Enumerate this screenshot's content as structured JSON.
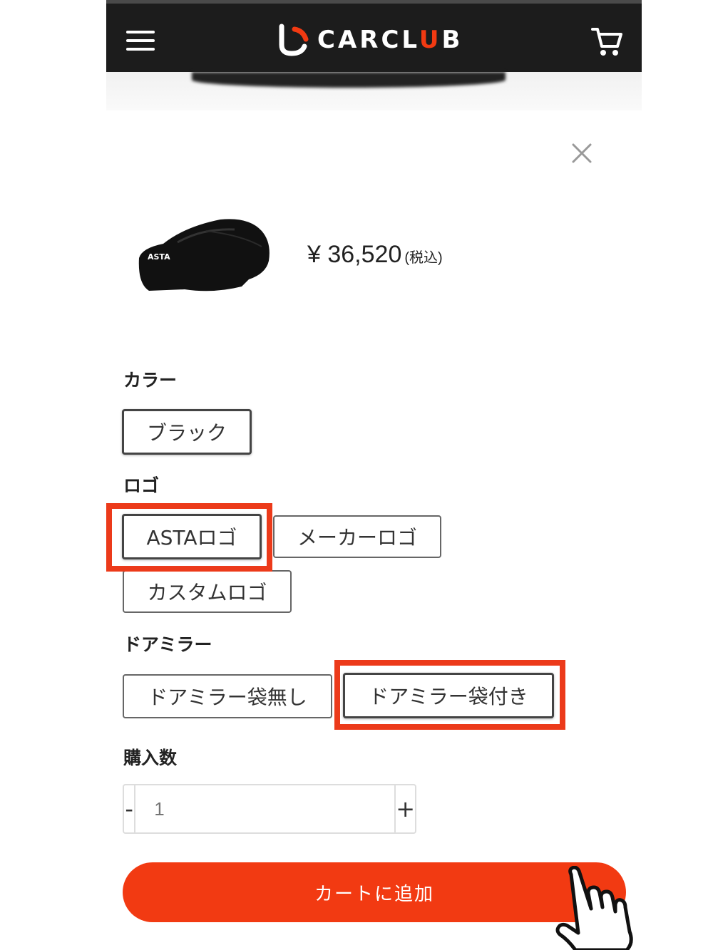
{
  "header": {
    "logo_text_a": "CARCL",
    "logo_text_b": "U",
    "logo_text_c": "B",
    "menu_icon": "hamburger-icon",
    "cart_icon": "shopping-cart-icon"
  },
  "product": {
    "price": "¥ 36,520",
    "tax_note": "(税込)",
    "thumb_logo_text": "ASTA"
  },
  "options": {
    "color_title": "カラー",
    "color_items": [
      "ブラック"
    ],
    "logo_title": "ロゴ",
    "logo_items": [
      "ASTAロゴ",
      "メーカーロゴ",
      "カスタムロゴ"
    ],
    "mirror_title": "ドアミラー",
    "mirror_items": [
      "ドアミラー袋無し",
      "ドアミラー袋付き"
    ]
  },
  "quantity": {
    "title": "購入数",
    "minus": "-",
    "plus": "+",
    "placeholder": "1"
  },
  "add_to_cart": "カートに追加",
  "colors": {
    "accent": "#f23a12",
    "header_bg": "#1c1c1c"
  }
}
